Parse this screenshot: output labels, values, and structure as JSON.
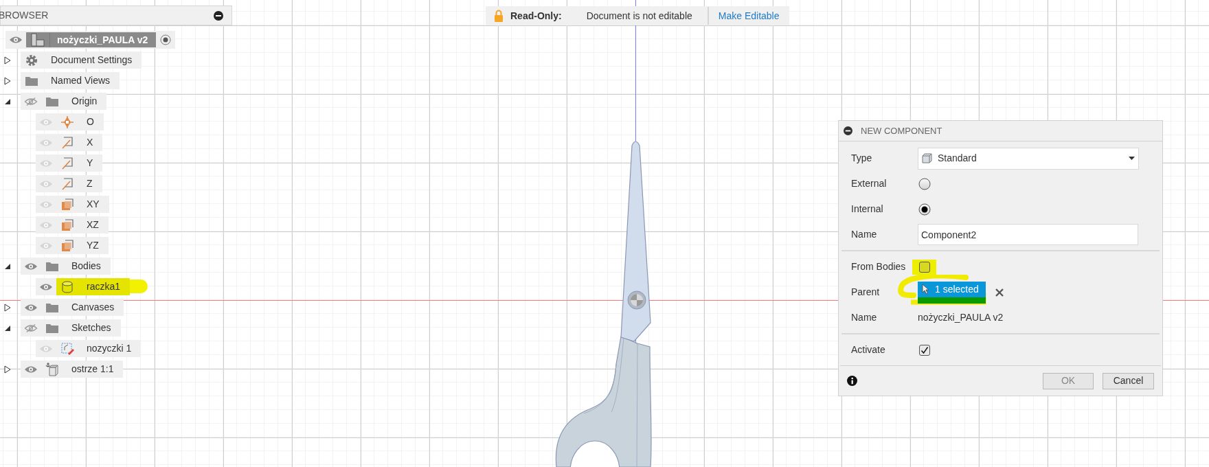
{
  "browser": {
    "title": "BROWSER",
    "root": {
      "label": "nożyczki_PAULA v2",
      "visible": true
    },
    "items": [
      {
        "label": "Document Settings",
        "kind": "gear",
        "expanded": false
      },
      {
        "label": "Named Views",
        "kind": "folder",
        "expanded": false
      },
      {
        "label": "Origin",
        "kind": "folder",
        "visible": false,
        "expanded": true,
        "children": [
          {
            "label": "O",
            "kind": "point",
            "visible": true,
            "dimmed": true
          },
          {
            "label": "X",
            "kind": "axis",
            "visible": true,
            "dimmed": true
          },
          {
            "label": "Y",
            "kind": "axis",
            "visible": true,
            "dimmed": true
          },
          {
            "label": "Z",
            "kind": "axis",
            "visible": true,
            "dimmed": true
          },
          {
            "label": "XY",
            "kind": "plane",
            "visible": true,
            "dimmed": true
          },
          {
            "label": "XZ",
            "kind": "plane",
            "visible": true,
            "dimmed": true
          },
          {
            "label": "YZ",
            "kind": "plane",
            "visible": true,
            "dimmed": true
          }
        ]
      },
      {
        "label": "Bodies",
        "kind": "folder",
        "visible": true,
        "expanded": true,
        "children": [
          {
            "label": "raczka1",
            "kind": "body",
            "visible": true,
            "dimmed": false,
            "highlighted": true
          }
        ]
      },
      {
        "label": "Canvases",
        "kind": "folder",
        "visible": true,
        "expanded": false
      },
      {
        "label": "Sketches",
        "kind": "folder",
        "visible": false,
        "expanded": true,
        "children": [
          {
            "label": "nozyczki 1",
            "kind": "sketch",
            "visible": true,
            "dimmed": true
          }
        ]
      },
      {
        "label": "ostrze 1:1",
        "kind": "component",
        "visible": true,
        "expanded": false
      }
    ]
  },
  "banner": {
    "title": "Read-Only:",
    "message": "Document is not editable",
    "action": "Make Editable"
  },
  "dialog": {
    "title": "NEW COMPONENT",
    "sections": [
      [
        {
          "kind": "select",
          "label": "Type",
          "value": "Standard"
        },
        {
          "kind": "radio",
          "label": "External",
          "selected": false
        },
        {
          "kind": "radio",
          "label": "Internal",
          "selected": true
        },
        {
          "kind": "input",
          "label": "Name",
          "value": "Component2"
        }
      ],
      [
        {
          "kind": "checkbox",
          "label": "From Bodies",
          "checked": false,
          "highlighted": true
        },
        {
          "kind": "selection",
          "label": "Parent",
          "value": "1 selected",
          "highlighted": true
        },
        {
          "kind": "text",
          "label": "Name",
          "value": "nożyczki_PAULA v2"
        }
      ],
      [
        {
          "kind": "checkbox",
          "label": "Activate",
          "checked": true,
          "highlighted": false
        }
      ]
    ],
    "buttons": [
      {
        "label": "OK",
        "disabled": true
      },
      {
        "label": "Cancel",
        "disabled": false
      }
    ]
  }
}
